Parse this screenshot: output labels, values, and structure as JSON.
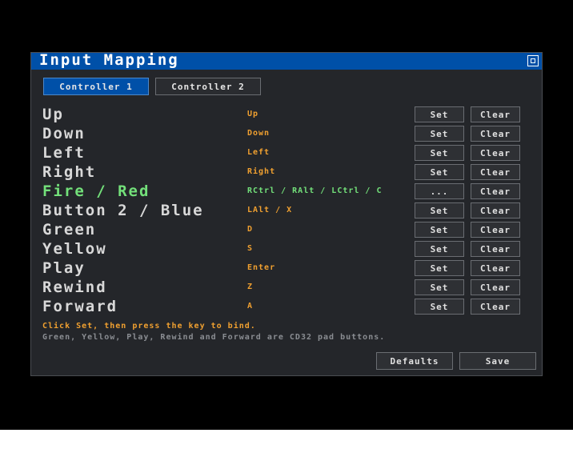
{
  "window": {
    "title": "Input Mapping",
    "close_icon": "window-close-icon"
  },
  "tabs": [
    {
      "label": "Controller 1",
      "selected": true
    },
    {
      "label": "Controller 2",
      "selected": false
    }
  ],
  "mappings": [
    {
      "label": "Up",
      "key": "Up",
      "set": "Set",
      "clear": "Clear"
    },
    {
      "label": "Down",
      "key": "Down",
      "set": "Set",
      "clear": "Clear"
    },
    {
      "label": "Left",
      "key": "Left",
      "set": "Set",
      "clear": "Clear"
    },
    {
      "label": "Right",
      "key": "Right",
      "set": "Set",
      "clear": "Clear"
    },
    {
      "label": "Fire / Red",
      "key": "RCtrl / RAlt / LCtrl / C",
      "set": "...",
      "clear": "Clear",
      "active": true
    },
    {
      "label": "Button 2 / Blue",
      "key": "LAlt / X",
      "set": "Set",
      "clear": "Clear"
    },
    {
      "label": "Green",
      "key": "D",
      "set": "Set",
      "clear": "Clear"
    },
    {
      "label": "Yellow",
      "key": "S",
      "set": "Set",
      "clear": "Clear"
    },
    {
      "label": "Play",
      "key": "Enter",
      "set": "Set",
      "clear": "Clear"
    },
    {
      "label": "Rewind",
      "key": "Z",
      "set": "Set",
      "clear": "Clear"
    },
    {
      "label": "Forward",
      "key": "A",
      "set": "Set",
      "clear": "Clear"
    }
  ],
  "hints": {
    "primary": "Click Set, then press the key to bind.",
    "secondary": "Green, Yellow, Play, Rewind and Forward are CD32 pad buttons."
  },
  "footer": {
    "defaults_label": "Defaults",
    "save_label": "Save"
  },
  "colors": {
    "title_bar": "#0050a8",
    "window_bg": "#24262a",
    "key_text": "#f0a030",
    "active_text": "#73e07a"
  }
}
